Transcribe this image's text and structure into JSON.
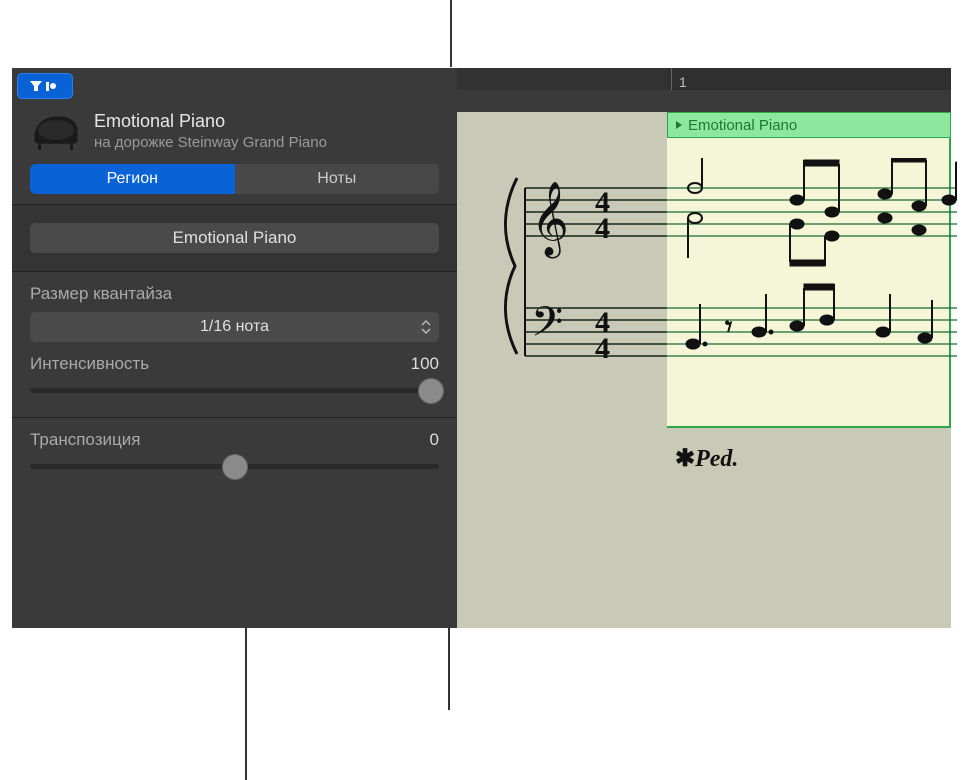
{
  "header": {
    "region_name": "Emotional Piano",
    "track_subtitle": "на дорожке Steinway Grand Piano"
  },
  "tabs": {
    "region": "Регион",
    "notes": "Ноты"
  },
  "name_field": "Emotional Piano",
  "quantize": {
    "label": "Размер квантайза",
    "value": "1/16 нота"
  },
  "intensity": {
    "label": "Интенсивность",
    "value": "100",
    "percent": 100
  },
  "transpose": {
    "label": "Транспозиция",
    "value": "0",
    "percent": 50
  },
  "ruler": {
    "bar_number": "1"
  },
  "score": {
    "region_label": "Emotional Piano",
    "pedal_mark": "✱𝆮Ped.",
    "time_sig_top": "4",
    "time_sig_bottom": "4"
  }
}
